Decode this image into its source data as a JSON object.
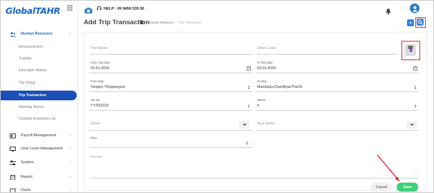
{
  "app": {
    "logo_text_1": "Global",
    "logo_text_2": "TAHR"
  },
  "topbar": {
    "help_text": "HELP : 09 9450 535 00"
  },
  "sidebar": {
    "section": "Human Resource",
    "sub_items": [
      "Announcement",
      "Transfer",
      "Education History",
      "Trip Setup",
      "Trip Transaction",
      "Warning Report",
      "Contract Employee List"
    ],
    "active_sub": "Trip Transaction",
    "items": [
      "Payroll Management",
      "User Level Management",
      "System",
      "Report",
      "Claim"
    ]
  },
  "page": {
    "title": "Add Trip Transaction",
    "breadcrumb": {
      "section": "Human Resource",
      "separator": "/",
      "current": "Trip Transaction"
    },
    "add_label": "+"
  },
  "form": {
    "trip_name": {
      "placeholder": "Trip Name",
      "value": ""
    },
    "short_code": {
      "placeholder": "Short Code",
      "value": ""
    },
    "from_trip_date": {
      "label": "From Trip Date",
      "value": "02-01-2024"
    },
    "to_trip_date": {
      "label": "To Trip Date",
      "value": "03-01-2024"
    },
    "from_way": {
      "label": "From Way",
      "value": "Yangon,Thingangyun"
    },
    "to_way": {
      "label": "To Way",
      "value": "Mandalay,ChanMyaeTharSi"
    },
    "car_no": {
      "label": "Car No",
      "value": "YY/022323"
    },
    "wheel": {
      "label": "Wheel",
      "value": "6"
    },
    "driver": {
      "placeholder": "Driver"
    },
    "asst_driver": {
      "placeholder": "Asst Driver"
    },
    "price": {
      "label": "Price",
      "value": "0"
    },
    "remark": {
      "placeholder": "Remark"
    }
  },
  "actions": {
    "cancel": "Cancel",
    "save": "Save"
  },
  "colors": {
    "primary": "#1a4fb8",
    "accent": "#2f7fe0",
    "save": "#3fd07a",
    "highlight": "#e2262c"
  }
}
